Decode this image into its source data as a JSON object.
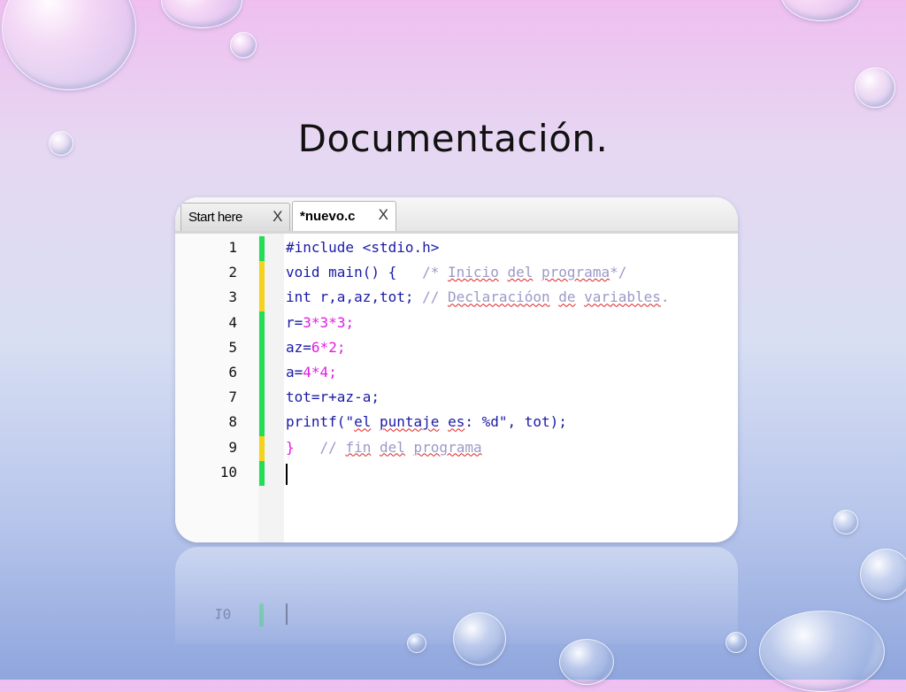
{
  "slide": {
    "title": "Documentación."
  },
  "editor": {
    "tabs": [
      {
        "label": "Start here",
        "close": "X",
        "active": false
      },
      {
        "label": "*nuevo.c",
        "close": "X",
        "active": true
      }
    ],
    "lines": [
      {
        "number": "1",
        "marker": "green"
      },
      {
        "number": "2",
        "marker": "yellow"
      },
      {
        "number": "3",
        "marker": "yellow"
      },
      {
        "number": "4",
        "marker": "green"
      },
      {
        "number": "5",
        "marker": "green"
      },
      {
        "number": "6",
        "marker": "green"
      },
      {
        "number": "7",
        "marker": "green"
      },
      {
        "number": "8",
        "marker": "green"
      },
      {
        "number": "9",
        "marker": "yellow"
      },
      {
        "number": "10",
        "marker": "green"
      }
    ],
    "code": {
      "l1": {
        "directive": "#include",
        "header": " <stdio.h>"
      },
      "l2": {
        "keyword": "void",
        "text": " main() {",
        "comment_pre": "   /* ",
        "w1": "Inicio",
        "sp1": " ",
        "w2": "del",
        "sp2": " ",
        "w3": "programa",
        "comment_post": "*/"
      },
      "l3": {
        "keyword": "int",
        "text": " r,a,az,tot;",
        "comment_pre": " // ",
        "w1": "Declaracióon",
        "sp1": " ",
        "w2": "de",
        "sp2": " ",
        "w3": "variables",
        "comment_post": "."
      },
      "l4": {
        "a": "r=",
        "n1": "3",
        "o1": "*",
        "n2": "3",
        "o2": "*",
        "n3": "3",
        "end": ";"
      },
      "l5": {
        "a": "az=",
        "n1": "6",
        "o1": "*",
        "n2": "2",
        "end": ";"
      },
      "l6": {
        "a": "a=",
        "n1": "4",
        "o1": "*",
        "n2": "4",
        "end": ";"
      },
      "l7": {
        "text": "tot=r+az-a;"
      },
      "l8": {
        "fn": "printf(",
        "q1": "\"",
        "w1": "el",
        "sp1": " ",
        "w2": "puntaje",
        "sp2": " ",
        "w3": "es",
        "s2": ": %d\"",
        "rest": ", tot);"
      },
      "l9": {
        "brace": "}",
        "comment_pre": "   // ",
        "w1": "fin",
        "sp1": " ",
        "w2": "del",
        "sp2": " ",
        "w3": "programa"
      }
    }
  },
  "colors": {
    "keyword": "#1a1aa6",
    "number": "#e21be2",
    "comment": "#9a9ac8",
    "marker_green": "#22dd55",
    "marker_yellow": "#f5d21c"
  }
}
